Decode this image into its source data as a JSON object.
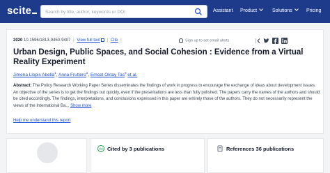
{
  "header": {
    "logo": "scite",
    "search_placeholder": "Search by title, author, keywords or DOI",
    "nav": [
      {
        "label": "Assistant",
        "has_menu": false
      },
      {
        "label": "Product",
        "has_menu": true
      },
      {
        "label": "Solutions",
        "has_menu": true
      },
      {
        "label": "Pricing",
        "has_menu": false
      }
    ]
  },
  "paper": {
    "year": "2020",
    "doi": "10.1596/1813-9450-9407",
    "view_full_text": "View full text",
    "cite": "Cite",
    "alerts": "Sign up to set email alerts",
    "title": "Urban Design, Public Spaces, and Social Cohesion : Evidence from a Virtual Reality Experiment",
    "authors": [
      {
        "name": "Jimena Llopis Abella",
        "sup": "1"
      },
      {
        "name": "Anna Fruttero",
        "sup": "2"
      },
      {
        "name": "Emcet Oktay Tas",
        "sup": "3"
      }
    ],
    "et_al": "et al.",
    "abstract_label": "Abstract:",
    "abstract_text": "The Policy Research Working Paper Series disseminates the findings of work in progress to encourage the exchange of ideas about development issues. An objective of the series is to get the findings out quickly, even if the presentations are less than fully polished. The papers carry the names of the authors and should be cited accordingly. The findings, interpretations, and conclusions expressed in this paper are entirely those of the authors. They do not necessarily represent the views of the International Ba...",
    "show_more": "Show more",
    "help_link": "Help me understand this report"
  },
  "panels": {
    "cited_by": "Cited by 3 publications",
    "references": "References 36 publications"
  },
  "colors": {
    "header_bg": "#1e3a8a",
    "link": "#1d4ed8",
    "cited_icon": "#16a34a",
    "references_icon": "#6b7280"
  }
}
